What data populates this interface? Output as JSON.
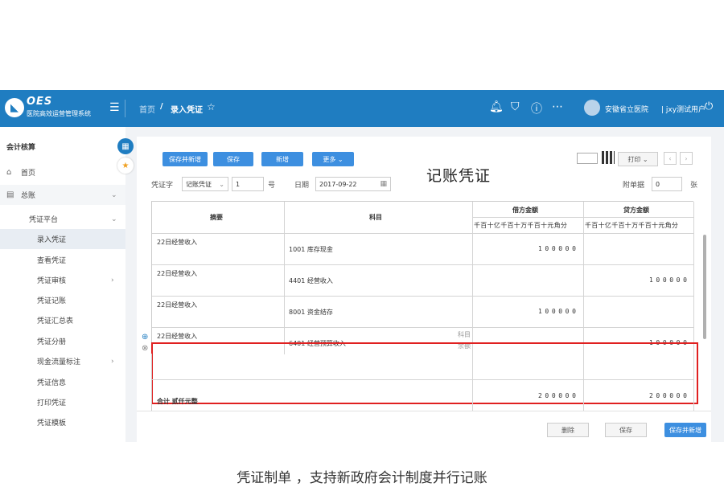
{
  "app": {
    "logo_text": "OES",
    "system_name": "医院高效运营管理系统",
    "breadcrumb_home": "首页",
    "breadcrumb_sep": "/",
    "breadcrumb_current": "录入凭证",
    "org": "安徽省立医院",
    "user": "| jxy测试用户"
  },
  "sidebar": {
    "header": "会计核算",
    "items": [
      {
        "label": "首页",
        "icon": "home-icon"
      },
      {
        "label": "总账",
        "icon": "ledger-icon"
      },
      {
        "label": "凭证平台"
      },
      {
        "label": "录入凭证"
      },
      {
        "label": "查看凭证"
      },
      {
        "label": "凭证审核"
      },
      {
        "label": "凭证记账"
      },
      {
        "label": "凭证汇总表"
      },
      {
        "label": "凭证分册"
      },
      {
        "label": "现金流量标注"
      },
      {
        "label": "凭证信息"
      },
      {
        "label": "打印凭证"
      },
      {
        "label": "凭证模板"
      }
    ]
  },
  "toolbar": {
    "save_new": "保存并新增",
    "save": "保存",
    "new": "新增",
    "more": "更多 ⌄",
    "print": "打印 ⌄"
  },
  "voucher": {
    "title": "记账凭证",
    "type_label": "凭证字",
    "type_value": "记账凭证",
    "number": "1",
    "number_suffix": "号",
    "date_label": "日期",
    "date_value": "2017-09-22",
    "attach_label": "附单据",
    "attach_value": "0",
    "attach_suffix": "张"
  },
  "table": {
    "col_summary": "摘要",
    "col_account": "科目",
    "col_debit": "借方金额",
    "col_credit": "贷方金额",
    "units": "千百十亿千百十万千百十元角分",
    "rows": [
      {
        "summary": "22日经营收入",
        "account": "1001 库存现金",
        "debit": "100000",
        "credit": ""
      },
      {
        "summary": "22日经营收入",
        "account": "4401 经营收入",
        "debit": "",
        "credit": "100000"
      },
      {
        "summary": "22日经营收入",
        "account": "8001 资金结存",
        "debit": "100000",
        "credit": ""
      },
      {
        "summary": "22日经营收入",
        "account": "6401 经营预算收入",
        "debit": "",
        "credit": "100000"
      }
    ],
    "account_hint_1": "科目",
    "account_hint_2": "余额",
    "total_label": "合计  贰仟元整",
    "total_debit": "200000",
    "total_credit": "200000"
  },
  "footer": {
    "delete": "删除",
    "save": "保存",
    "save_new": "保存并新增"
  },
  "caption": "凭证制单 ，支持新政府会计制度并行记账",
  "colors": {
    "brand": "#1f7dc1",
    "button": "#3d8fe0",
    "highlight": "#e02020"
  }
}
